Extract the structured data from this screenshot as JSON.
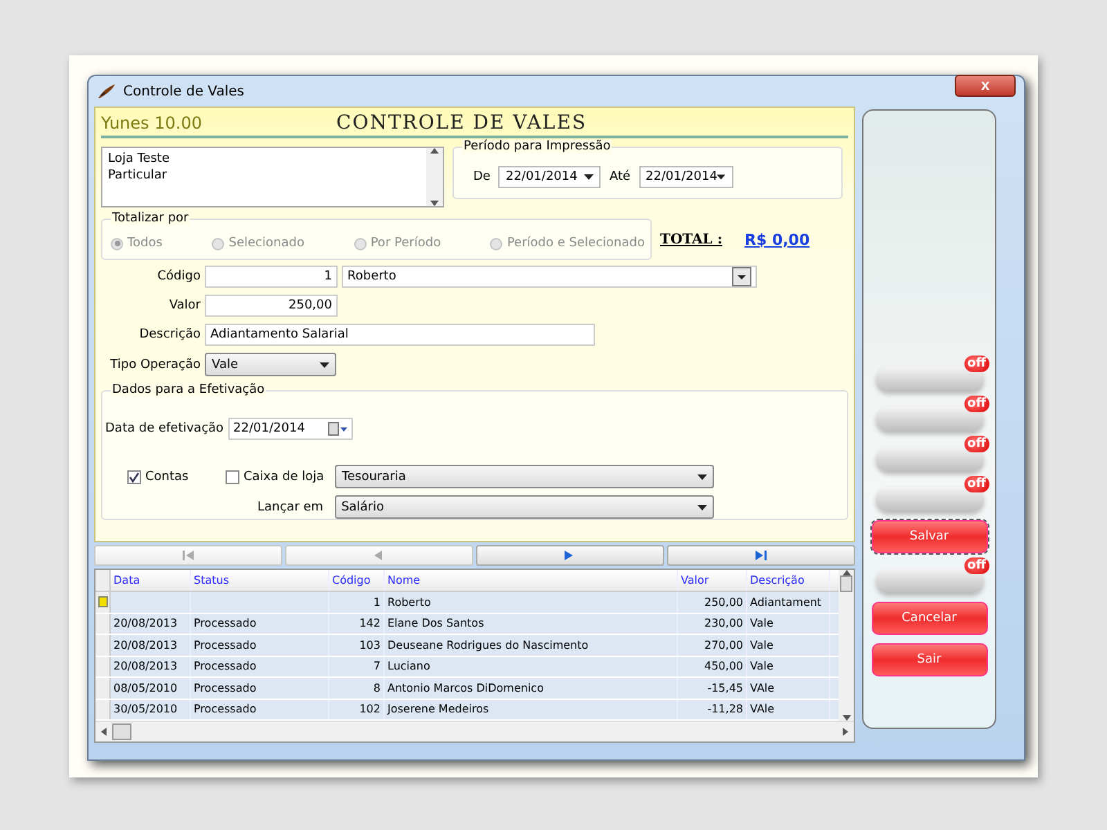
{
  "window": {
    "title": "Controle de Vales",
    "close": "x"
  },
  "header": {
    "user": "Yunes  10.00",
    "title": "CONTROLE DE VALES"
  },
  "store_list": {
    "items": [
      "Loja Teste",
      "Particular"
    ]
  },
  "print_period": {
    "legend": "Período para Impressão",
    "from_label": "De",
    "from_value": "22/01/2014",
    "to_label": "Até",
    "to_value": "22/01/2014"
  },
  "totalize": {
    "legend": "Totalizar por",
    "disabled": true,
    "options": [
      {
        "label": "Todos",
        "selected": true
      },
      {
        "label": "Selecionado",
        "selected": false
      },
      {
        "label": "Por Período",
        "selected": false
      },
      {
        "label": "Período e Selecionado",
        "selected": false
      }
    ]
  },
  "total": {
    "label": "TOTAL :",
    "value": "R$ 0,00"
  },
  "form": {
    "code_label": "Código",
    "code_value": "1",
    "name_value": "Roberto",
    "amount_label": "Valor",
    "amount_value": "250,00",
    "description_label": "Descrição",
    "description_value": "Adiantamento Salarial",
    "operation_label": "Tipo Operação",
    "operation_value": "Vale"
  },
  "settlement": {
    "legend": "Dados para a Efetivação",
    "date_label": "Data de efetivação",
    "date_value": "22/01/2014",
    "accounts": {
      "label": "Contas",
      "checked": true
    },
    "cash": {
      "label": "Caixa de loja",
      "checked": false
    },
    "cash_value": "Tesouraria",
    "post_label": "Lançar em",
    "post_value": "Salário"
  },
  "navigator": [
    {
      "kind": "first",
      "disabled": true
    },
    {
      "kind": "prev",
      "disabled": true
    },
    {
      "kind": "next",
      "disabled": false
    },
    {
      "kind": "last",
      "disabled": false
    }
  ],
  "table": {
    "columns": [
      "Data",
      "Status",
      "Código",
      "Nome",
      "Valor",
      "Descrição"
    ],
    "rows": [
      {
        "current": true,
        "cells": [
          "",
          "",
          "1",
          "Roberto",
          "250,00",
          "Adiantament"
        ]
      },
      {
        "current": false,
        "cells": [
          "20/08/2013",
          "Processado",
          "142",
          "Elane Dos Santos",
          "230,00",
          "Vale"
        ]
      },
      {
        "current": false,
        "cells": [
          "20/08/2013",
          "Processado",
          "103",
          "Deuseane Rodrigues do Nascimento",
          "270,00",
          "Vale"
        ]
      },
      {
        "current": false,
        "cells": [
          "20/08/2013",
          "Processado",
          "7",
          "Luciano",
          "450,00",
          "Vale"
        ]
      },
      {
        "current": false,
        "cells": [
          "08/05/2010",
          "Processado",
          "8",
          "Antonio Marcos DiDomenico",
          "-15,45",
          "VAle"
        ]
      },
      {
        "current": false,
        "cells": [
          "30/05/2010",
          "Processado",
          "102",
          "Joserene Medeiros",
          "-11,28",
          "VAle"
        ]
      }
    ]
  },
  "side_buttons": [
    {
      "kind": "off",
      "badge": "off"
    },
    {
      "kind": "off",
      "badge": "off"
    },
    {
      "kind": "off",
      "badge": "off"
    },
    {
      "kind": "off",
      "badge": "off"
    },
    {
      "kind": "action",
      "label": "Salvar",
      "focused": true
    },
    {
      "kind": "off",
      "badge": "off"
    },
    {
      "kind": "action",
      "label": "Cancelar",
      "focused": false
    },
    {
      "kind": "action",
      "label": "Sair",
      "focused": false
    }
  ]
}
